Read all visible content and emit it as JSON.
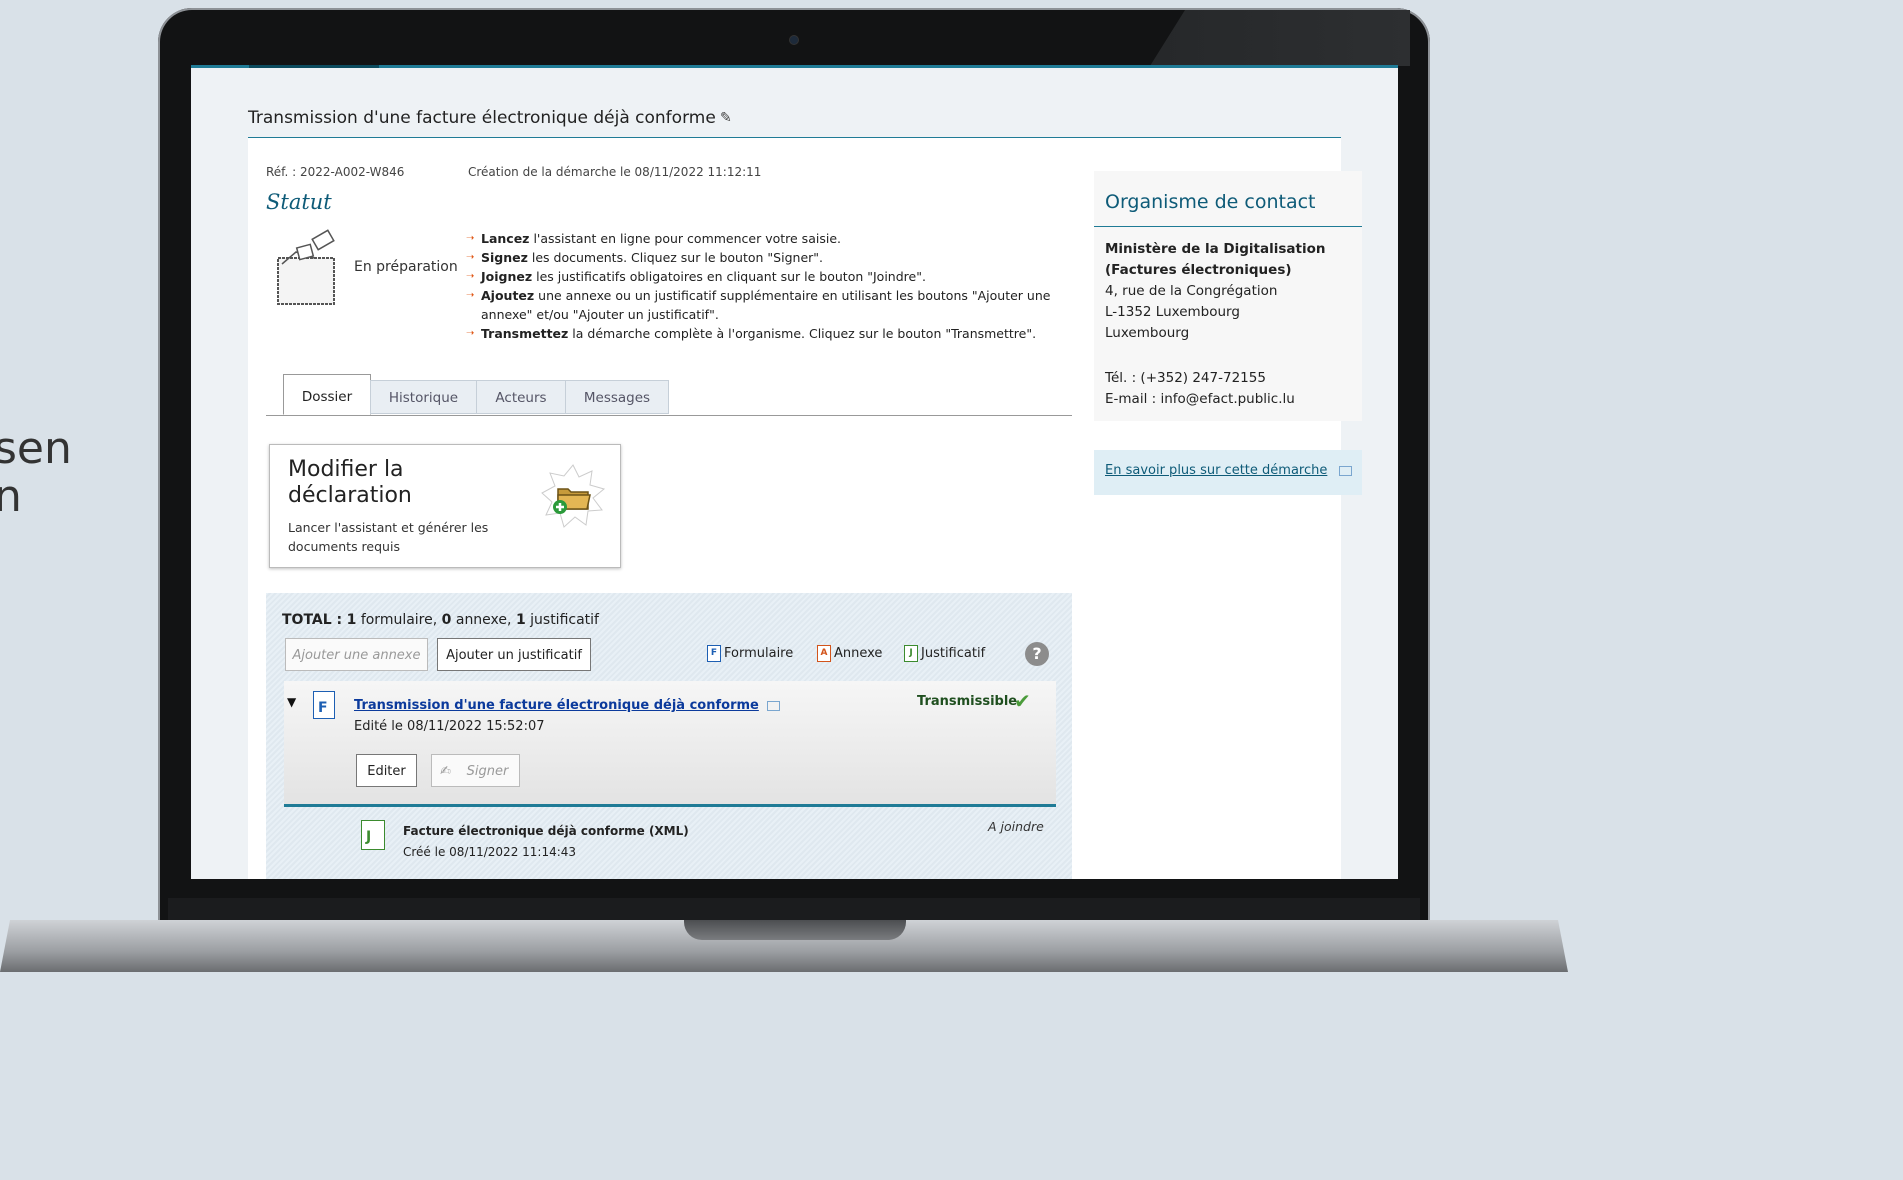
{
  "side_text": [
    "sen",
    "n"
  ],
  "window": {
    "title": "Transmission d'une facture électronique déjà conforme",
    "edit_icon": "pencil-icon"
  },
  "meta": {
    "ref": "Réf. : 2022-A002-W846",
    "created": "Création de la démarche le 08/11/2022 11:12:11"
  },
  "status": {
    "heading": "Statut",
    "state": "En préparation",
    "instructions": [
      {
        "bold": "Lancez",
        "text": " l'assistant en ligne pour commencer votre saisie."
      },
      {
        "bold": "Signez",
        "text": " les documents. Cliquez sur le bouton \"Signer\"."
      },
      {
        "bold": "Joignez",
        "text": " les justificatifs obligatoires en cliquant sur le bouton \"Joindre\"."
      },
      {
        "bold": "Ajoutez",
        "text": " une annexe ou un justificatif supplémentaire en utilisant les boutons \"Ajouter une annexe\" et/ou \"Ajouter un justificatif\"."
      },
      {
        "bold": "Transmettez",
        "text": " la démarche complète à l'organisme. Cliquez sur le bouton \"Transmettre\"."
      }
    ]
  },
  "tabs": [
    {
      "label": "Dossier",
      "active": true
    },
    {
      "label": "Historique",
      "active": false
    },
    {
      "label": "Acteurs",
      "active": false
    },
    {
      "label": "Messages",
      "active": false
    }
  ],
  "action_card": {
    "title": "Modifier la déclaration",
    "description": "Lancer l'assistant et générer les documents requis",
    "icon": "add-folder-icon"
  },
  "documents": {
    "total_label": "TOTAL :",
    "total_counts": {
      "formulaire": "1",
      "annexe": "0",
      "justificatif": "1"
    },
    "total_words": {
      "formulaire": "formulaire,",
      "annexe": "annexe,",
      "justificatif": "justificatif"
    },
    "add_annex_button": "Ajouter une annexe",
    "add_justif_button": "Ajouter un justificatif",
    "legend": {
      "formulaire": "Formulaire",
      "annexe": "Annexe",
      "justificatif": "Justificatif"
    },
    "legend_letters": {
      "formulaire": "F",
      "annexe": "A",
      "justificatif": "J"
    },
    "help": "?",
    "form_item": {
      "link": "Transmission d'une facture électronique déjà conforme",
      "edited": "Edité le 08/11/2022 15:52:07",
      "status": "Transmissible",
      "edit_button": "Editer",
      "sign_button": "Signer"
    },
    "justif_item": {
      "title": "Facture électronique déjà conforme (XML)",
      "created": "Créé le 08/11/2022 11:14:43",
      "state": "A joindre"
    }
  },
  "contact": {
    "heading": "Organisme de contact",
    "org_line1": "Ministère de la Digitalisation",
    "org_line2": "(Factures électroniques)",
    "address1": "4, rue de la Congrégation",
    "address2": "L-1352 Luxembourg",
    "country": "Luxembourg",
    "tel": "Tél. : (+352) 247-72155",
    "email": "E-mail : info@efact.public.lu"
  },
  "more_link": "En savoir plus sur cette démarche",
  "colors": {
    "accent": "#1f7b96",
    "link": "#0b3a9c",
    "ok": "#4a9b3a",
    "bullet": "#e05a1a"
  }
}
